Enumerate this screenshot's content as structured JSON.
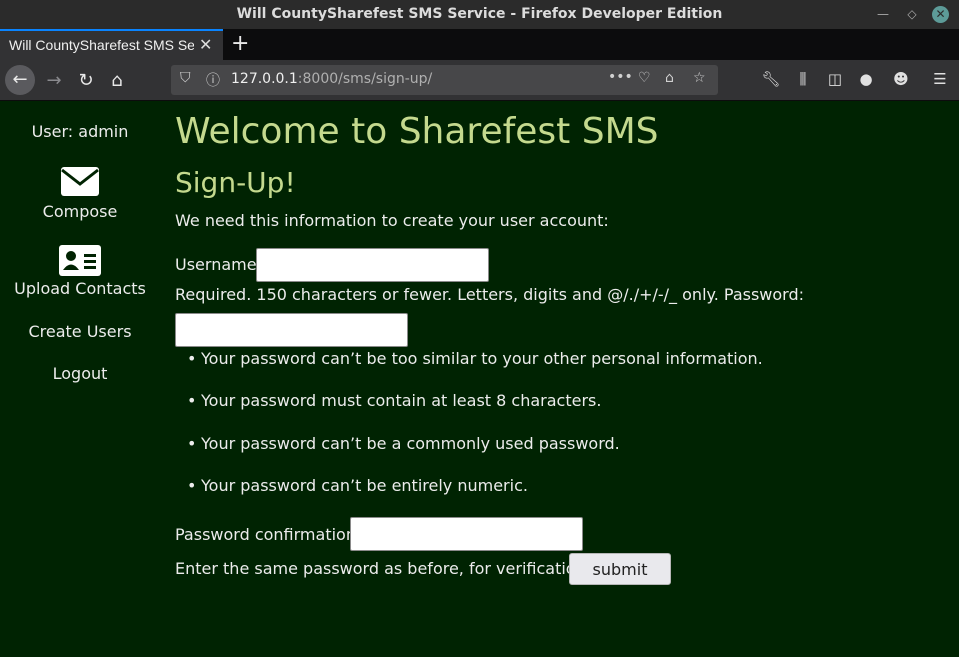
{
  "window": {
    "title": "Will CountySharefest SMS Service - Firefox Developer Edition"
  },
  "tabs": [
    {
      "label": "Will CountySharefest SMS Service",
      "active": true
    }
  ],
  "navbar": {
    "url_host": "127.0.0.1",
    "url_rest": ":8000/sms/sign-up/"
  },
  "sidebar": {
    "user_label": "User: admin",
    "items": [
      {
        "label": "Compose",
        "icon": "envelope-icon"
      },
      {
        "label": "Upload Contacts",
        "icon": "contact-card-icon"
      },
      {
        "label": "Create Users"
      },
      {
        "label": "Logout"
      }
    ]
  },
  "main": {
    "title": "Welcome to Sharefest SMS",
    "subtitle": "Sign-Up!",
    "intro": "We need this information to create your user account:",
    "username_label": "Username:",
    "username_value": "",
    "username_help": "Required. 150 characters or fewer. Letters, digits and @/./+/-/_ only.",
    "password_label": "Password:",
    "password_value": "",
    "password_rules": [
      "Your password can’t be too similar to your other personal information.",
      "Your password must contain at least 8 characters.",
      "Your password can’t be a commonly used password.",
      "Your password can’t be entirely numeric."
    ],
    "confirm_label": "Password confirmation:",
    "confirm_value": "",
    "confirm_help": "Enter the same password as before, for verification.",
    "submit_label": "submit"
  },
  "colors": {
    "page_bg": "#002302",
    "heading": "#c4d98e",
    "text": "#ececec",
    "accent": "#0a84ff"
  }
}
